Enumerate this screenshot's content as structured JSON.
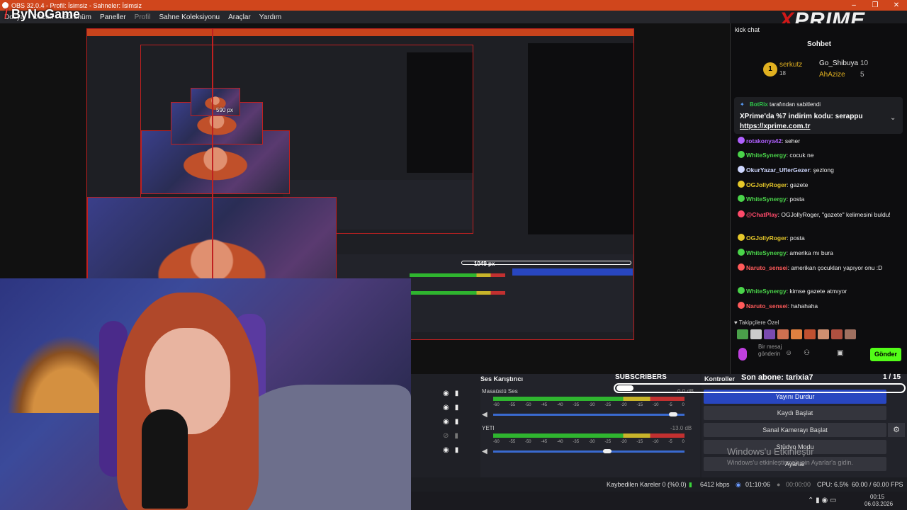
{
  "window": {
    "title": "OBS 32.0.4 - Profil: İsimsiz - Sahneler: İsimsiz",
    "controls": [
      "–",
      "❐",
      "✕"
    ]
  },
  "brand": {
    "logo": "ByNoGame",
    "xprime": "PRIME"
  },
  "menu": [
    {
      "label": "Dosya",
      "dim": false
    },
    {
      "label": "Düzen",
      "dim": false
    },
    {
      "label": "Görünüm",
      "dim": false
    },
    {
      "label": "Paneller",
      "dim": false
    },
    {
      "label": "Profil",
      "dim": true
    },
    {
      "label": "Sahne Koleksiyonu",
      "dim": false
    },
    {
      "label": "Araçlar",
      "dim": false
    },
    {
      "label": "Yardım",
      "dim": false
    }
  ],
  "preview": {
    "measure_1": "1049 px",
    "measure_2": "590 px",
    "measure_3": "590 px"
  },
  "chat": {
    "tab": "kick chat",
    "title": "Sohbet",
    "top": [
      {
        "name": "serkutz",
        "value": "18",
        "color": "#e0b020"
      },
      {
        "name": "Go_Shibuya",
        "value": "10",
        "color": "#eee"
      },
      {
        "name": "AhAzize",
        "value": "5",
        "color": "#e0b020"
      }
    ],
    "pinned": {
      "by": "BotRix",
      "by_suffix": "tarafından sabitlendi",
      "text": "XPrime'da %7 indirim kodu: serappu",
      "link": "https://xprime.com.tr"
    },
    "messages": [
      {
        "user": "rotakonya42",
        "color": "#b060ff",
        "text": "seher"
      },
      {
        "user": "WhiteSynergy",
        "color": "#4ad44a",
        "text": "cocuk ne"
      },
      {
        "user": "OkurYazar_UflerGezer",
        "color": "#cfd8ff",
        "text": "şezlong"
      },
      {
        "user": "OGJollyRoger",
        "color": "#e6c82a",
        "text": "gazete"
      },
      {
        "user": "WhiteSynergy",
        "color": "#4ad44a",
        "text": "posta"
      },
      {
        "user": "@ChatPlay",
        "color": "#ff4a6a",
        "text": "OGJollyRoger, \"gazete\" kelimesini buldu!"
      },
      {
        "user": "OGJollyRoger",
        "color": "#e6c82a",
        "text": "posta"
      },
      {
        "user": "WhiteSynergy",
        "color": "#4ad44a",
        "text": "amerika mı bura"
      },
      {
        "user": "Naruto_sensei",
        "color": "#ff5a5a",
        "text": "amerikan çocukları yapıyor onu :D"
      },
      {
        "user": "WhiteSynergy",
        "color": "#4ad44a",
        "text": "kimse gazete atmıyor"
      },
      {
        "user": "Naruto_sensei",
        "color": "#ff5a5a",
        "text": "hahahaha"
      }
    ],
    "followers_label": "Takipçilere Özel",
    "input_placeholder": "Bir mesaj gönderin",
    "send": "Gönder"
  },
  "subs": {
    "label": "SUBSCRIBERS",
    "last": "Son abone: tarixia7",
    "count": "1 / 15"
  },
  "mixer": {
    "title": "Ses Karıştırıcı",
    "channels": [
      {
        "name": "Masaüstü Ses",
        "db": "0.0 dB",
        "level": 0.96
      },
      {
        "name": "YETI",
        "db": "-13.0 dB",
        "level": 0.6
      }
    ],
    "ticks": [
      "-60",
      "-55",
      "-50",
      "-45",
      "-40",
      "-35",
      "-30",
      "-25",
      "-20",
      "-15",
      "-10",
      "-5",
      "0"
    ]
  },
  "controls": {
    "title": "Kontroller",
    "buttons": [
      "Yayını Durdur",
      "Kaydı Başlat",
      "Sanal Kamerayı Başlat",
      "Stüdyo Modu",
      "Ayarlar"
    ]
  },
  "status": {
    "dropped": "Kaybedilen Kareler 0 (%0.0)",
    "bitrate": "6412 kbps",
    "live": "01:10:06",
    "rec": "00:00:00",
    "cpu": "CPU: 6.5%",
    "fps": "60.00 / 60.00 FPS"
  },
  "taskbar": {
    "time": "00:15",
    "date": "06.03.2026"
  },
  "watermark": {
    "line1": "Windows'u Etkinleştir",
    "line2": "Windows'u etkinleştirmek için Ayarlar'a gidin."
  }
}
